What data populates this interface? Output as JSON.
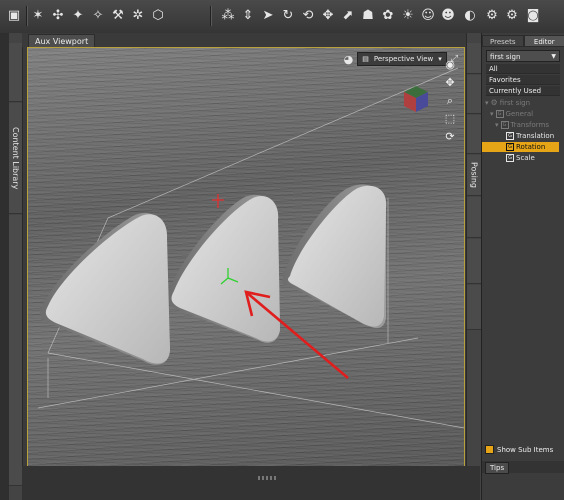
{
  "viewport": {
    "tab_label": "Aux Viewport",
    "view_mode": "Perspective View",
    "accent_color": "#e6a417",
    "border_color": "#b8a13a"
  },
  "left_tabs": [
    {
      "label": "Content Library",
      "dim": false
    },
    {
      "label": "",
      "dim": true
    }
  ],
  "right_tabs": [
    {
      "label": "Posing",
      "dim": false
    },
    {
      "label": "",
      "dim": true
    }
  ],
  "panel": {
    "tabs": [
      "Presets",
      "Editor"
    ],
    "active_tab": "Editor",
    "selector_value": "first sign",
    "filters": [
      "All",
      "Favorites",
      "Currently Used"
    ],
    "tree": [
      {
        "label": "first sign",
        "dim": true,
        "indent": 0,
        "icon": "figure-icon"
      },
      {
        "label": "General",
        "dim": true,
        "indent": 1,
        "icon": "group-icon"
      },
      {
        "label": "Transforms",
        "dim": true,
        "indent": 2,
        "icon": "group-icon"
      },
      {
        "label": "Translation",
        "dim": false,
        "indent": 3,
        "icon": "property-icon"
      },
      {
        "label": "Rotation",
        "dim": false,
        "indent": 3,
        "icon": "property-icon",
        "selected": true
      },
      {
        "label": "Scale",
        "dim": false,
        "indent": 3,
        "icon": "property-icon"
      }
    ],
    "show_sub_items": "Show Sub Items",
    "tips_tab": "Tips"
  }
}
